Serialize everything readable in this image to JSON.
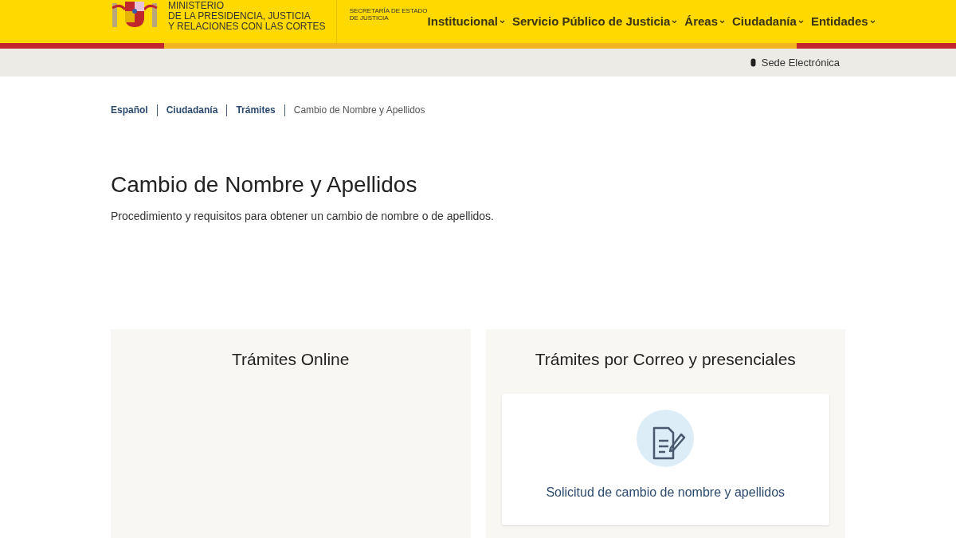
{
  "header": {
    "ministry_lines": [
      "MINISTERIO",
      "DE LA PRESIDENCIA, JUSTICIA",
      "Y RELACIONES CON LAS CORTES"
    ],
    "secretariat_lines": [
      "SECRETARÍA DE ESTADO",
      "DE JUSTICIA"
    ],
    "nav": [
      {
        "label": "Institucional"
      },
      {
        "label": "Servicio Público de Justicia"
      },
      {
        "label": "Áreas"
      },
      {
        "label": "Ciudadanía"
      },
      {
        "label": "Entidades"
      }
    ]
  },
  "utility_bar": {
    "link": "Sede Electrónica"
  },
  "breadcrumbs": [
    {
      "label": "Español",
      "kind": "link"
    },
    {
      "label": "Ciudadanía",
      "kind": "link"
    },
    {
      "label": "Trámites",
      "kind": "link"
    },
    {
      "label": "Cambio de Nombre y Apellidos",
      "kind": "current"
    }
  ],
  "page": {
    "title": "Cambio de Nombre y Apellidos",
    "description": "Procedimiento y requisitos para obtener un cambio de nombre o de apellidos."
  },
  "sections": [
    {
      "title": "Trámites Online"
    },
    {
      "title": "Trámites por Correo y presenciales",
      "items": [
        {
          "label": "Solicitud de cambio de nombre y apellidos"
        }
      ]
    }
  ]
}
